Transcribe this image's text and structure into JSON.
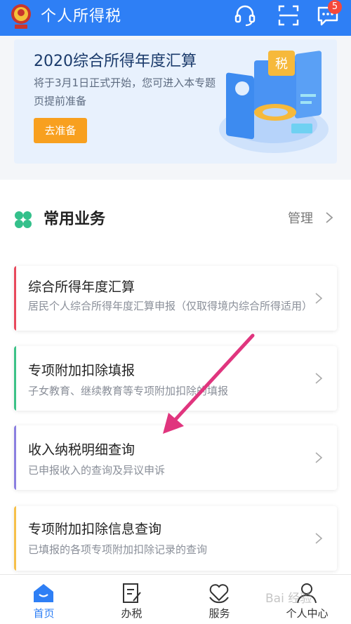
{
  "header": {
    "title": "个人所得税",
    "message_badge": "5",
    "color": "#2e7ff5"
  },
  "banner": {
    "title": "2020综合所得年度汇算",
    "subtitle": "将于3月1日正式开始，您可进入本专题页提前准备",
    "button_label": "去准备",
    "illustration_text": "税"
  },
  "services": {
    "title": "常用业务",
    "manage_label": "管理",
    "cards": [
      {
        "title": "综合所得年度汇算",
        "subtitle": "居民个人综合所得年度汇算申报（仅取得境内综合所得适用）",
        "accent": "#e8495c"
      },
      {
        "title": "专项附加扣除填报",
        "subtitle": "子女教育、继续教育等专项附加扣除的填报",
        "accent": "#3cc287"
      },
      {
        "title": "收入纳税明细查询",
        "subtitle": "已申报收入的查询及异议申诉",
        "accent": "#8b7fe0"
      },
      {
        "title": "专项附加扣除信息查询",
        "subtitle": "已填报的各项专项附加扣除记录的查询",
        "accent": "#f6c04a"
      }
    ]
  },
  "bottom_nav": [
    {
      "label": "首页",
      "icon": "home-icon",
      "active": true
    },
    {
      "label": "办税",
      "icon": "document-icon",
      "active": false
    },
    {
      "label": "服务",
      "icon": "heart-hand-icon",
      "active": false
    },
    {
      "label": "个人中心",
      "icon": "person-icon",
      "active": false
    }
  ],
  "watermark": "Bai 经验"
}
